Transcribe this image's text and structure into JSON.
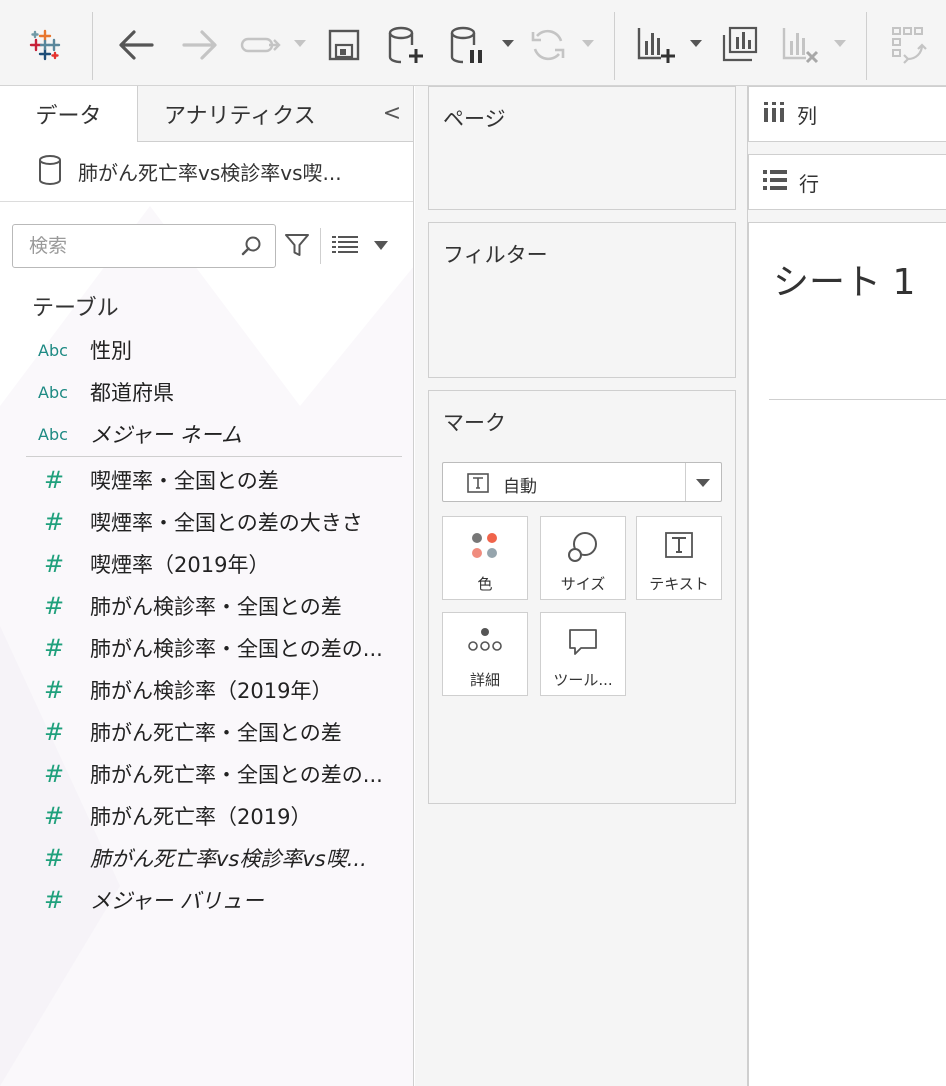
{
  "toolbar": {
    "items": [
      {
        "icon": "tableau-logo-icon"
      },
      {
        "icon": "back-arrow-icon"
      },
      {
        "icon": "forward-arrow-icon"
      },
      {
        "icon": "redo-icon"
      },
      {
        "icon": "save-icon"
      },
      {
        "icon": "add-data-source-icon"
      },
      {
        "icon": "pause-data-source-icon"
      },
      {
        "icon": "refresh-icon"
      },
      {
        "icon": "new-worksheet-icon"
      },
      {
        "icon": "duplicate-sheet-icon"
      },
      {
        "icon": "clear-sheet-icon"
      },
      {
        "icon": "swap-icon"
      }
    ],
    "colors": {
      "accent": "#1f77b4",
      "dim": "#c4c4c4"
    }
  },
  "data_pane": {
    "tab_data": "データ",
    "tab_analytics": "アナリティクス",
    "collapse_glyph": "<",
    "datasource_name": "肺がん死亡率vs検診率vs喫...",
    "search_placeholder": "検索",
    "section_tables": "テーブル",
    "dimensions": [
      {
        "type": "Abc",
        "name": "性別",
        "italic": false
      },
      {
        "type": "Abc",
        "name": "都道府県",
        "italic": false
      },
      {
        "type": "Abc",
        "name": "メジャー ネーム",
        "italic": true
      }
    ],
    "measures": [
      {
        "type": "#",
        "name": "喫煙率・全国との差",
        "italic": false
      },
      {
        "type": "#",
        "name": "喫煙率・全国との差の大きさ",
        "italic": false
      },
      {
        "type": "#",
        "name": "喫煙率（2019年）",
        "italic": false
      },
      {
        "type": "#",
        "name": "肺がん検診率・全国との差",
        "italic": false
      },
      {
        "type": "#",
        "name": "肺がん検診率・全国との差の...",
        "italic": false
      },
      {
        "type": "#",
        "name": "肺がん検診率（2019年）",
        "italic": false
      },
      {
        "type": "#",
        "name": "肺がん死亡率・全国との差",
        "italic": false
      },
      {
        "type": "#",
        "name": "肺がん死亡率・全国との差の...",
        "italic": false
      },
      {
        "type": "#",
        "name": "肺がん死亡率（2019）",
        "italic": false
      },
      {
        "type": "#",
        "name": "肺がん死亡率vs検診率vs喫...",
        "italic": true
      },
      {
        "type": "#",
        "name": "メジャー バリュー",
        "italic": true
      }
    ],
    "colors": {
      "dimension": "#1d8a83",
      "measure": "#1fa07c"
    }
  },
  "shelves": {
    "pages": "ページ",
    "filters": "フィルター",
    "marks": "マーク",
    "mark_type": "自動",
    "mark_buttons": [
      {
        "label": "色",
        "icon": "color-icon"
      },
      {
        "label": "サイズ",
        "icon": "size-icon"
      },
      {
        "label": "テキスト",
        "icon": "text-icon"
      },
      {
        "label": "詳細",
        "icon": "detail-icon"
      },
      {
        "label": "ツール...",
        "icon": "tooltip-icon"
      }
    ],
    "columns": "列",
    "rows": "行"
  },
  "sheet": {
    "title": "シート 1"
  }
}
